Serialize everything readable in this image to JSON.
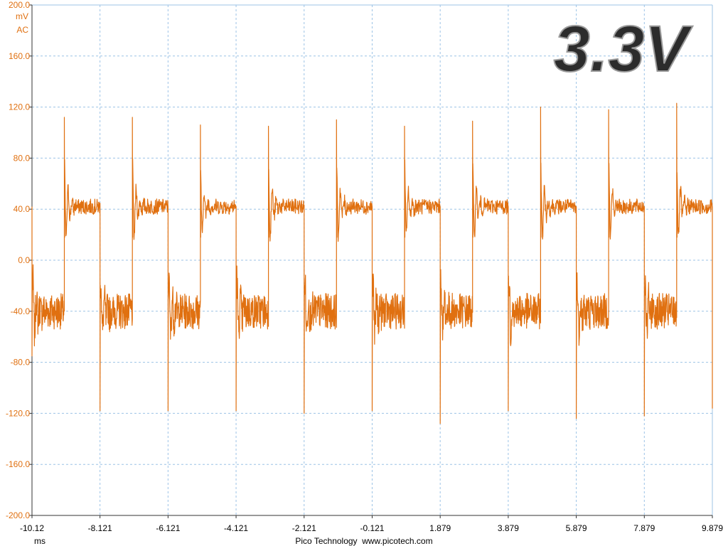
{
  "chart_data": {
    "type": "line",
    "title": "3.3V",
    "y_unit": "mV",
    "y_coupling": "AC",
    "x_unit": "ms",
    "footer": "Pico Technology  www.picotech.com",
    "ylim": [
      -200.0,
      200.0
    ],
    "xlim": [
      -10.12,
      9.879
    ],
    "yticks": [
      "200.0",
      "160.0",
      "120.0",
      "80.0",
      "40.0",
      "0.0",
      "-40.0",
      "-80.0",
      "-120.0",
      "-160.0",
      "-200.0"
    ],
    "ytick_values": [
      200,
      160,
      120,
      80,
      40,
      0,
      -40,
      -80,
      -120,
      -160,
      -200
    ],
    "xticks": [
      "-10.12",
      "-8.121",
      "-6.121",
      "-4.121",
      "-2.121",
      "-0.121",
      "1.879",
      "3.879",
      "5.879",
      "7.879",
      "9.879"
    ],
    "xtick_values": [
      -10.12,
      -8.121,
      -6.121,
      -4.121,
      -2.121,
      -0.121,
      1.879,
      3.879,
      5.879,
      7.879,
      9.879
    ],
    "grid": true,
    "series": [
      {
        "description_waveform": "square-wave ripple",
        "period_ms": 2.0,
        "high_level_mV": 42,
        "low_level_mV": -40,
        "rising_edges_ms": [
          -9.17,
          -7.17,
          -5.17,
          -3.17,
          -1.17,
          0.83,
          2.83,
          4.83,
          6.83,
          8.83
        ],
        "rising_spike_peak_mV": [
          112,
          112,
          106,
          105,
          110,
          105,
          109,
          120,
          118,
          123
        ],
        "falling_edges_ms": [
          -10.12,
          -8.121,
          -6.121,
          -4.121,
          -2.121,
          -0.121,
          1.879,
          3.879,
          5.879,
          7.879,
          9.879
        ],
        "falling_spike_min_mV": [
          -75,
          -118,
          -118,
          -118,
          -120,
          -118,
          -128,
          -118,
          -124,
          -122,
          -116
        ],
        "color": "#e07010"
      }
    ],
    "colors": {
      "trace": "#e07010",
      "grid": "#9cc3e6",
      "axis_text": "#e07010"
    }
  }
}
